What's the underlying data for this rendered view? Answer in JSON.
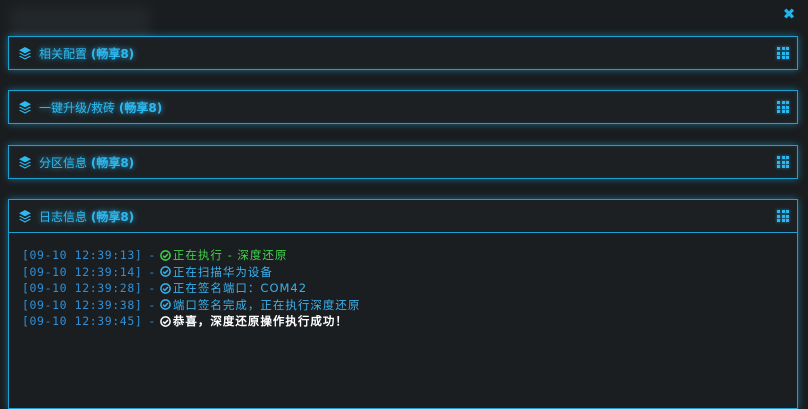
{
  "window": {
    "close_symbol": "✖"
  },
  "panels": [
    {
      "title": "相关配置",
      "tag": "(畅享8)"
    },
    {
      "title": "一键升级/救砖",
      "tag": "(畅享8)"
    },
    {
      "title": "分区信息",
      "tag": "(畅享8)"
    },
    {
      "title": "日志信息",
      "tag": "(畅享8)"
    }
  ],
  "icons": {
    "panel_icon": "layers-icon",
    "menu_icon": "grid-icon",
    "close_icon": "close-icon",
    "status_icon": "check-circle-icon"
  },
  "log": [
    {
      "time": "[09-10 12:39:13]",
      "dash": "-",
      "text": "正在执行 - 深度还原",
      "status": "success"
    },
    {
      "time": "[09-10 12:39:14]",
      "dash": "-",
      "text": "正在扫描华为设备",
      "status": "info"
    },
    {
      "time": "[09-10 12:39:28]",
      "dash": "-",
      "text": "正在签名端口：COM42",
      "status": "info"
    },
    {
      "time": "[09-10 12:39:38]",
      "dash": "-",
      "text": "端口签名完成，正在执行深度还原",
      "status": "info"
    },
    {
      "time": "[09-10 12:39:45]",
      "dash": "-",
      "text": "恭喜，深度还原操作执行成功！",
      "status": "done"
    }
  ],
  "colors": {
    "accent": "#1e9fd0",
    "success": "#3fd24a",
    "info": "#3ab0ec",
    "done": "#ffffff",
    "background": "#1a1d1f"
  }
}
